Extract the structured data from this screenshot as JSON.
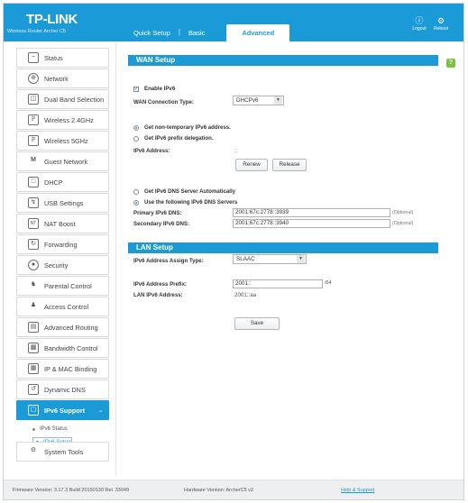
{
  "header": {
    "logo": "TP-LINK",
    "model": "Wireless Router Archer C5",
    "tabs": [
      "Quick Setup",
      "Basic",
      "Advanced"
    ],
    "separator": "|",
    "logout": "Logout",
    "reboot": "Reboot",
    "accent_color": "#1b9ad8"
  },
  "sidebar": {
    "items": [
      {
        "label": "Status",
        "icon": "status-icon"
      },
      {
        "label": "Network",
        "icon": "globe-icon"
      },
      {
        "label": "Dual Band Selection",
        "icon": "dual-band-icon"
      },
      {
        "label": "Wireless 2.4GHz",
        "icon": "wifi-icon"
      },
      {
        "label": "Wireless 5GHz",
        "icon": "wifi-icon"
      },
      {
        "label": "Guest Network",
        "icon": "guest-icon"
      },
      {
        "label": "DHCP",
        "icon": "dhcp-icon"
      },
      {
        "label": "USB Settings",
        "icon": "usb-icon"
      },
      {
        "label": "NAT Boost",
        "icon": "nat-icon"
      },
      {
        "label": "Forwarding",
        "icon": "forwarding-icon"
      },
      {
        "label": "Security",
        "icon": "security-icon"
      },
      {
        "label": "Parental Control",
        "icon": "parental-icon"
      },
      {
        "label": "Access Control",
        "icon": "access-icon"
      },
      {
        "label": "Advanced Routing",
        "icon": "routing-icon"
      },
      {
        "label": "Bandwidth Control",
        "icon": "bandwidth-icon"
      },
      {
        "label": "IP & MAC Binding",
        "icon": "binding-icon"
      },
      {
        "label": "Dynamic DNS",
        "icon": "ddns-icon"
      },
      {
        "label": "IPv6 Support",
        "icon": "ipv6-icon"
      }
    ],
    "submenu": [
      "IPv6 Status",
      "IPv6 Setup"
    ],
    "system_tools": "System Tools"
  },
  "wan": {
    "title": "WAN Setup",
    "enable_label": "Enable IPv6",
    "conn_type_label": "WAN Connection Type:",
    "conn_type_value": "DHCPv6",
    "radio_nontemp": "Get non-temporary IPv6 address.",
    "radio_prefix": "Get IPv6 prefix delegation.",
    "ipv6_addr_label": "IPv6 Address:",
    "ipv6_addr_value": "::",
    "renew": "Renew",
    "release": "Release",
    "dns_auto": "Get IPv6 DNS Server Automatically",
    "dns_manual": "Use the following IPv6 DNS Servers",
    "primary_label": "Primary IPv6 DNS:",
    "primary_value": "2001:67c:2778::3939",
    "secondary_label": "Secondary IPv6 DNS:",
    "secondary_value": "2001:67c:2778::3940",
    "optional": "(Optional)"
  },
  "lan": {
    "title": "LAN Setup",
    "assign_label": "IPv6 Address Assign Type:",
    "assign_value": "SLAAC",
    "prefix_label": "IPv6 Address Prefix:",
    "prefix_value": "2001::",
    "prefix_suffix": "/64",
    "lan_addr_label": "LAN IPv6 Address:",
    "lan_addr_value": "2001::aa",
    "save": "Save"
  },
  "help_icon": "?",
  "footer": {
    "firmware": "Firmware Version: 3.17.3 Build 20150130 Rel. 33049",
    "hardware": "Hardware Version: ArcherC5 v2",
    "help": "Help & Support"
  }
}
